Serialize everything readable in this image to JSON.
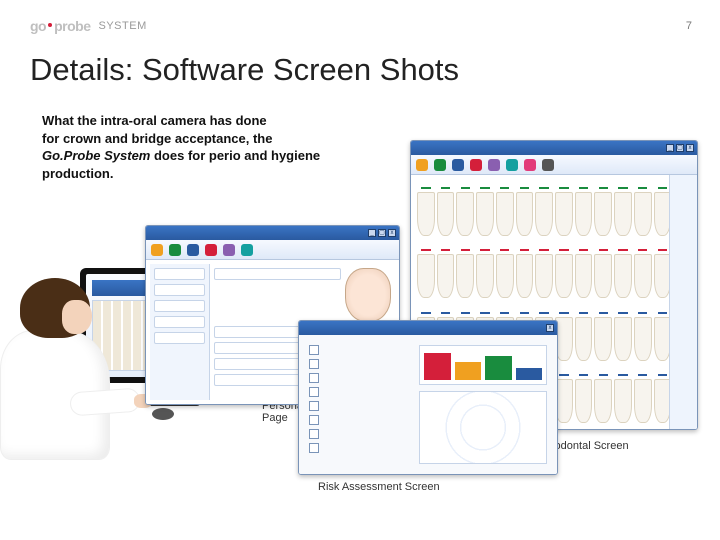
{
  "page_number": "7",
  "header": {
    "logo_go": "go",
    "logo_probe": "probe",
    "system_label": "SYSTEM"
  },
  "title": "Details: Software Screen Shots",
  "lead": {
    "line1": "What the intra-oral camera has done",
    "line2": "for crown and bridge acceptance, the",
    "brand": "Go.Probe System",
    "line3_tail": " does for perio and hygiene",
    "line4": "production."
  },
  "captions": {
    "personal": "Personal Page",
    "risk": "Risk Assessment Screen",
    "perio": "Periodontal Screen"
  },
  "toolbar_icon_colors": [
    "#f0a020",
    "#198c3e",
    "#2a5aa0",
    "#d41f3a",
    "#8a5fb0",
    "#14a0a0",
    "#e23b7a",
    "#555"
  ]
}
